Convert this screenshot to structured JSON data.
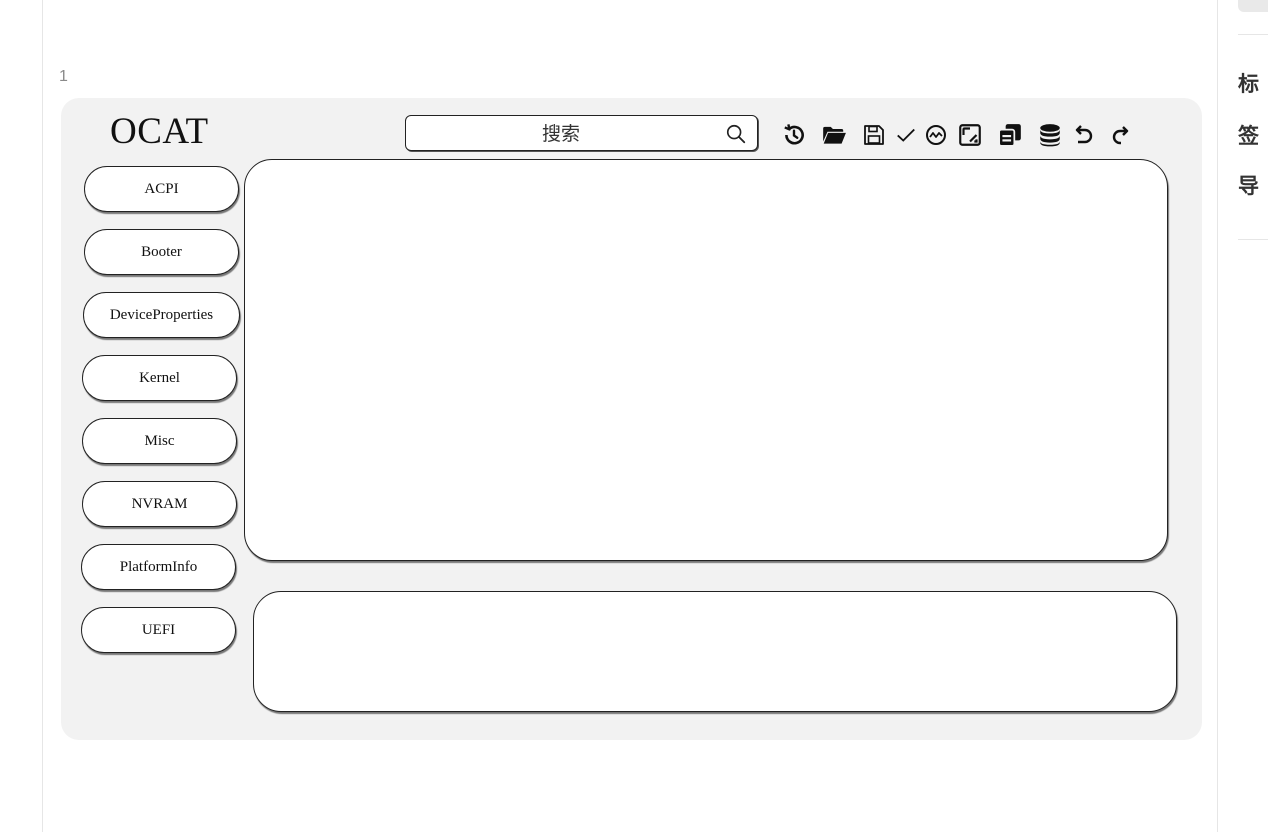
{
  "editor": {
    "line_number": "1"
  },
  "app": {
    "title": "OCAT",
    "search": {
      "placeholder": "搜索"
    },
    "toolbar": [
      {
        "icon": "history-icon",
        "label": "history"
      },
      {
        "icon": "folder-open-icon",
        "label": "open"
      },
      {
        "icon": "save-icon",
        "label": "save"
      },
      {
        "icon": "check-icon",
        "label": "check"
      },
      {
        "icon": "compare-icon",
        "label": "compare"
      },
      {
        "icon": "edit-square-icon",
        "label": "edit"
      },
      {
        "icon": "copy-icon",
        "label": "copy"
      },
      {
        "icon": "database-icon",
        "label": "database"
      },
      {
        "icon": "undo-icon",
        "label": "undo"
      },
      {
        "icon": "redo-icon",
        "label": "redo"
      }
    ],
    "nav": [
      {
        "label": "ACPI"
      },
      {
        "label": "Booter"
      },
      {
        "label": "DeviceProperties"
      },
      {
        "label": "Kernel"
      },
      {
        "label": "Misc"
      },
      {
        "label": "NVRAM"
      },
      {
        "label": "PlatformInfo"
      },
      {
        "label": "UEFI"
      }
    ]
  },
  "toc": {
    "label_chars": [
      "标",
      "签",
      "导"
    ]
  },
  "colors": {
    "canvas": "#f2f2f2",
    "panel": "#ffffff",
    "stroke": "#222222"
  }
}
